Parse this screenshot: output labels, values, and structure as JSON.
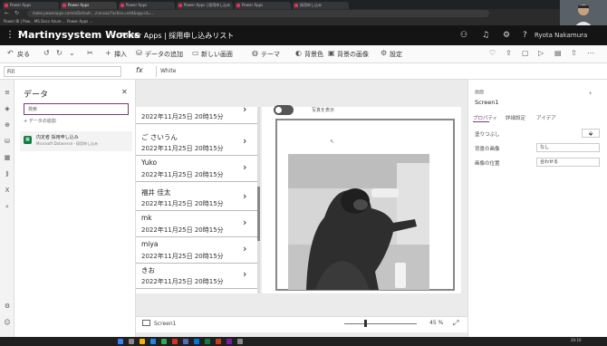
{
  "browser": {
    "tabs": [
      "Power Apps",
      "Power Apps",
      "Power Apps",
      "Power Apps | 採用申し込み",
      "Power Apps",
      "採用申し込み"
    ],
    "address": "make.powerapps.com/e/Default-.../canvas/?action=edit&app-id=...",
    "bookmarks": "Power BI | Pow...   MS Docs   Azure ...   Power Apps ..."
  },
  "header": {
    "env_name": "Martinysystem Works",
    "app_title": "Power Apps  |  採用申し込みリスト",
    "user_name": "Ryota Nakamura"
  },
  "toolbar": {
    "back": "戻る",
    "insert": "挿入",
    "add_data": "データの追加",
    "new_screen": "新しい画面",
    "theme": "テーマ",
    "background_color": "背景色",
    "background_image": "背景の画像",
    "settings": "設定"
  },
  "formula": {
    "property": "Fill",
    "fx": "fx",
    "value": "White"
  },
  "data_pane": {
    "title": "データ",
    "search_placeholder": "検索",
    "add_data": "+ データの追加",
    "source_name": "内定者 採用申し込み",
    "source_sub": "Microsoft Dataverse - 採用申し込み"
  },
  "gallery": {
    "items": [
      {
        "name": "",
        "date": "2022年11月25日 20時15分"
      },
      {
        "name": "ご さいうん",
        "date": "2022年11月25日 20時15分"
      },
      {
        "name": "Yuko",
        "date": "2022年11月25日 20時15分"
      },
      {
        "name": "福井  佳太",
        "date": "2022年11月25日 20時15分"
      },
      {
        "name": "mk",
        "date": "2022年11月25日 20時15分"
      },
      {
        "name": "miya",
        "date": "2022年11月25日 20時15分"
      },
      {
        "name": "きお",
        "date": "2022年11月25日 20時15分"
      }
    ]
  },
  "canvas": {
    "toggle_label": "写真を表示",
    "screen_name": "Screen1",
    "zoom": "45 %"
  },
  "properties": {
    "kind": "画面",
    "name": "Screen1",
    "tabs": [
      "プロパティ",
      "詳細設定",
      "アイデア"
    ],
    "fill_label": "塗りつぶし",
    "bg_image_label": "背景の画像",
    "bg_image_value": "なし",
    "image_position_label": "画像の位置",
    "image_position_value": "合わせる"
  },
  "taskbar": {
    "clock": "20:16"
  }
}
